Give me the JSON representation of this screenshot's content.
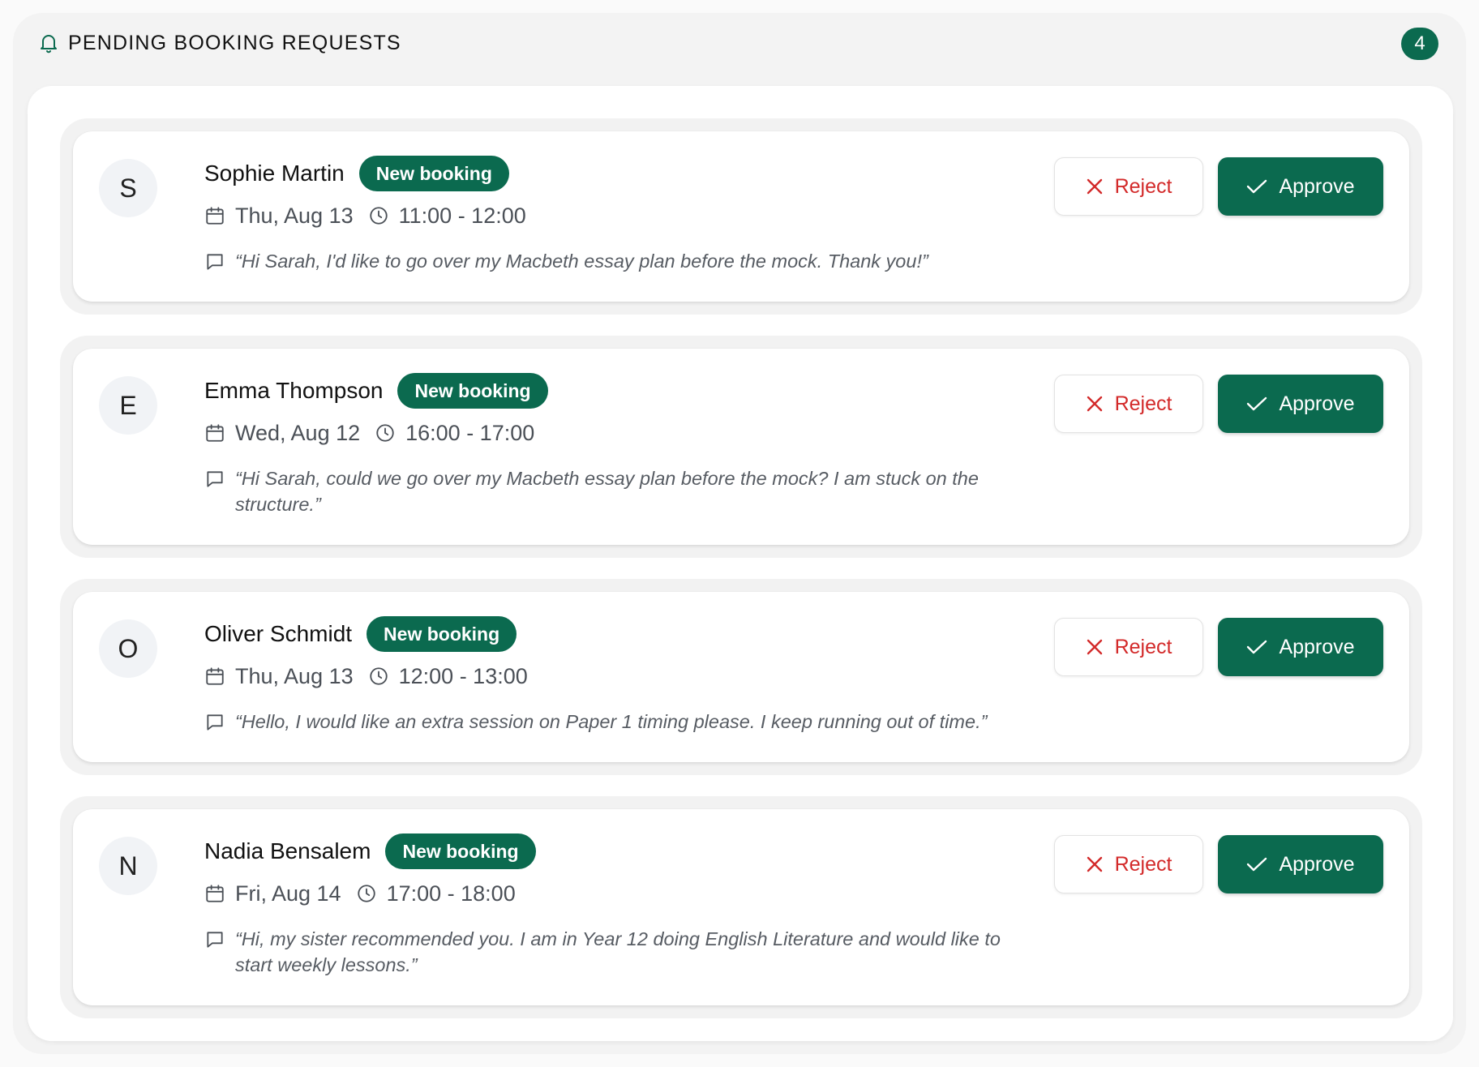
{
  "header": {
    "title": "PENDING BOOKING REQUESTS",
    "count": "4",
    "icon": "bell-icon"
  },
  "colors": {
    "accent": "#0b6a4f",
    "reject": "#d32a2a"
  },
  "requests": [
    {
      "initial": "S",
      "name": "Sophie Martin",
      "tag": "New booking",
      "date": "Thu, Aug 13",
      "time": "11:00 - 12:00",
      "message": "“Hi Sarah, I'd like to go over my Macbeth essay plan before the mock. Thank you!”",
      "reject_label": "Reject",
      "approve_label": "Approve"
    },
    {
      "initial": "E",
      "name": "Emma Thompson",
      "tag": "New booking",
      "date": "Wed, Aug 12",
      "time": "16:00 - 17:00",
      "message": "“Hi Sarah, could we go over my Macbeth essay plan before the mock? I am stuck on the structure.”",
      "reject_label": "Reject",
      "approve_label": "Approve"
    },
    {
      "initial": "O",
      "name": "Oliver Schmidt",
      "tag": "New booking",
      "date": "Thu, Aug 13",
      "time": "12:00 - 13:00",
      "message": "“Hello, I would like an extra session on Paper 1 timing please. I keep running out of time.”",
      "reject_label": "Reject",
      "approve_label": "Approve"
    },
    {
      "initial": "N",
      "name": "Nadia Bensalem",
      "tag": "New booking",
      "date": "Fri, Aug 14",
      "time": "17:00 - 18:00",
      "message": "“Hi, my sister recommended you. I am in Year 12 doing English Literature and would like to start weekly lessons.”",
      "reject_label": "Reject",
      "approve_label": "Approve"
    }
  ]
}
